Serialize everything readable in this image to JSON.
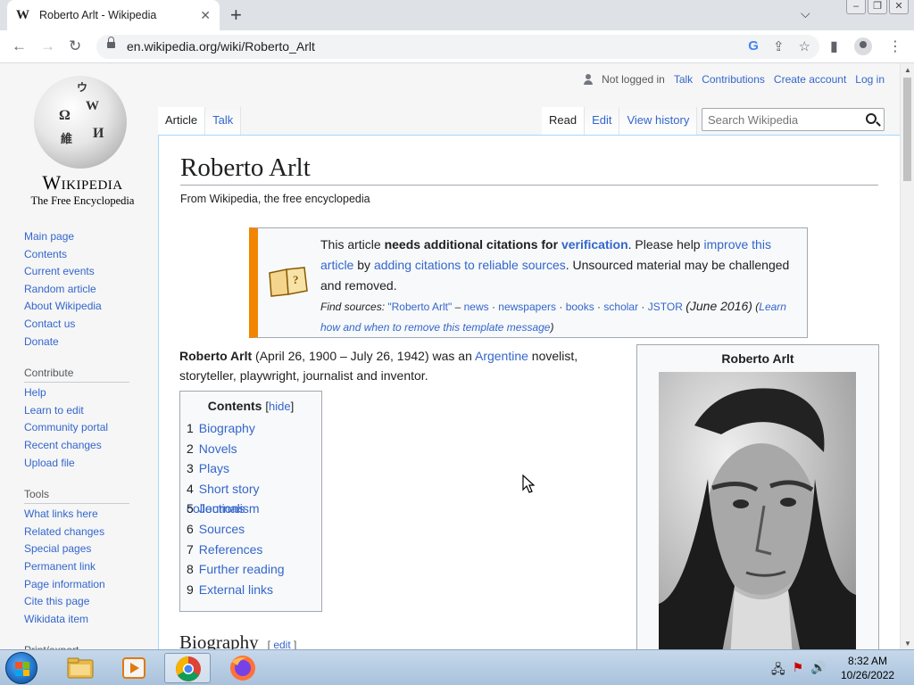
{
  "browser": {
    "tab_title": "Roberto Arlt - Wikipedia",
    "tab_favicon": "W",
    "close_tab": "✕",
    "new_tab": "+",
    "url": "en.wikipedia.org/wiki/Roberto_Arlt"
  },
  "user_nav": {
    "not_logged_in": "Not logged in",
    "talk": "Talk",
    "contributions": "Contributions",
    "create_account": "Create account",
    "log_in": "Log in"
  },
  "logo": {
    "wordmark": "Wikipedia",
    "tagline": "The Free Encyclopedia"
  },
  "sidebar": {
    "main": [
      "Main page",
      "Contents",
      "Current events",
      "Random article",
      "About Wikipedia",
      "Contact us",
      "Donate"
    ],
    "contribute_heading": "Contribute",
    "contribute": [
      "Help",
      "Learn to edit",
      "Community portal",
      "Recent changes",
      "Upload file"
    ],
    "tools_heading": "Tools",
    "tools": [
      "What links here",
      "Related changes",
      "Special pages",
      "Permanent link",
      "Page information",
      "Cite this page",
      "Wikidata item"
    ],
    "print_heading": "Print/export"
  },
  "page_tabs": {
    "article": "Article",
    "talk": "Talk",
    "read": "Read",
    "edit": "Edit",
    "history": "View history"
  },
  "search": {
    "placeholder": "Search Wikipedia"
  },
  "article": {
    "title": "Roberto Arlt",
    "from": "From Wikipedia, the free encyclopedia",
    "notice": {
      "p1": "This article ",
      "p2": "needs additional citations for ",
      "p3": "verification",
      "p4": ". Please help ",
      "p5": "improve this article",
      "p6": " by ",
      "p7": "adding citations to reliable sources",
      "p8": ". Unsourced material may be challenged and removed.",
      "find_label": "Find sources: ",
      "find_query": "\"Roberto Arlt\"",
      "dash": " – ",
      "news": "news",
      "newspapers": "newspapers",
      "books": "books",
      "scholar": "scholar",
      "jstor": "JSTOR",
      "date": "(June 2016)",
      "learn": "Learn how and when to remove this template message"
    },
    "lead_name": "Roberto Arlt",
    "lead_dates": " (April 26, 1900 – July 26, 1942) was an ",
    "lead_link": "Argentine",
    "lead_rest": " novelist, storyteller, playwright, journalist and inventor.",
    "toc": {
      "title": "Contents",
      "hide": "hide",
      "items": [
        {
          "num": "1",
          "label": "Biography"
        },
        {
          "num": "2",
          "label": "Novels"
        },
        {
          "num": "3",
          "label": "Plays"
        },
        {
          "num": "4",
          "label": "Short story collections"
        },
        {
          "num": "5",
          "label": "Journalism"
        },
        {
          "num": "6",
          "label": "Sources"
        },
        {
          "num": "7",
          "label": "References"
        },
        {
          "num": "8",
          "label": "Further reading"
        },
        {
          "num": "9",
          "label": "External links"
        }
      ]
    },
    "infobox_title": "Roberto Arlt",
    "section_heading": "Biography",
    "section_edit": "edit"
  },
  "taskbar": {
    "time": "8:32 AM",
    "date": "10/26/2022"
  }
}
